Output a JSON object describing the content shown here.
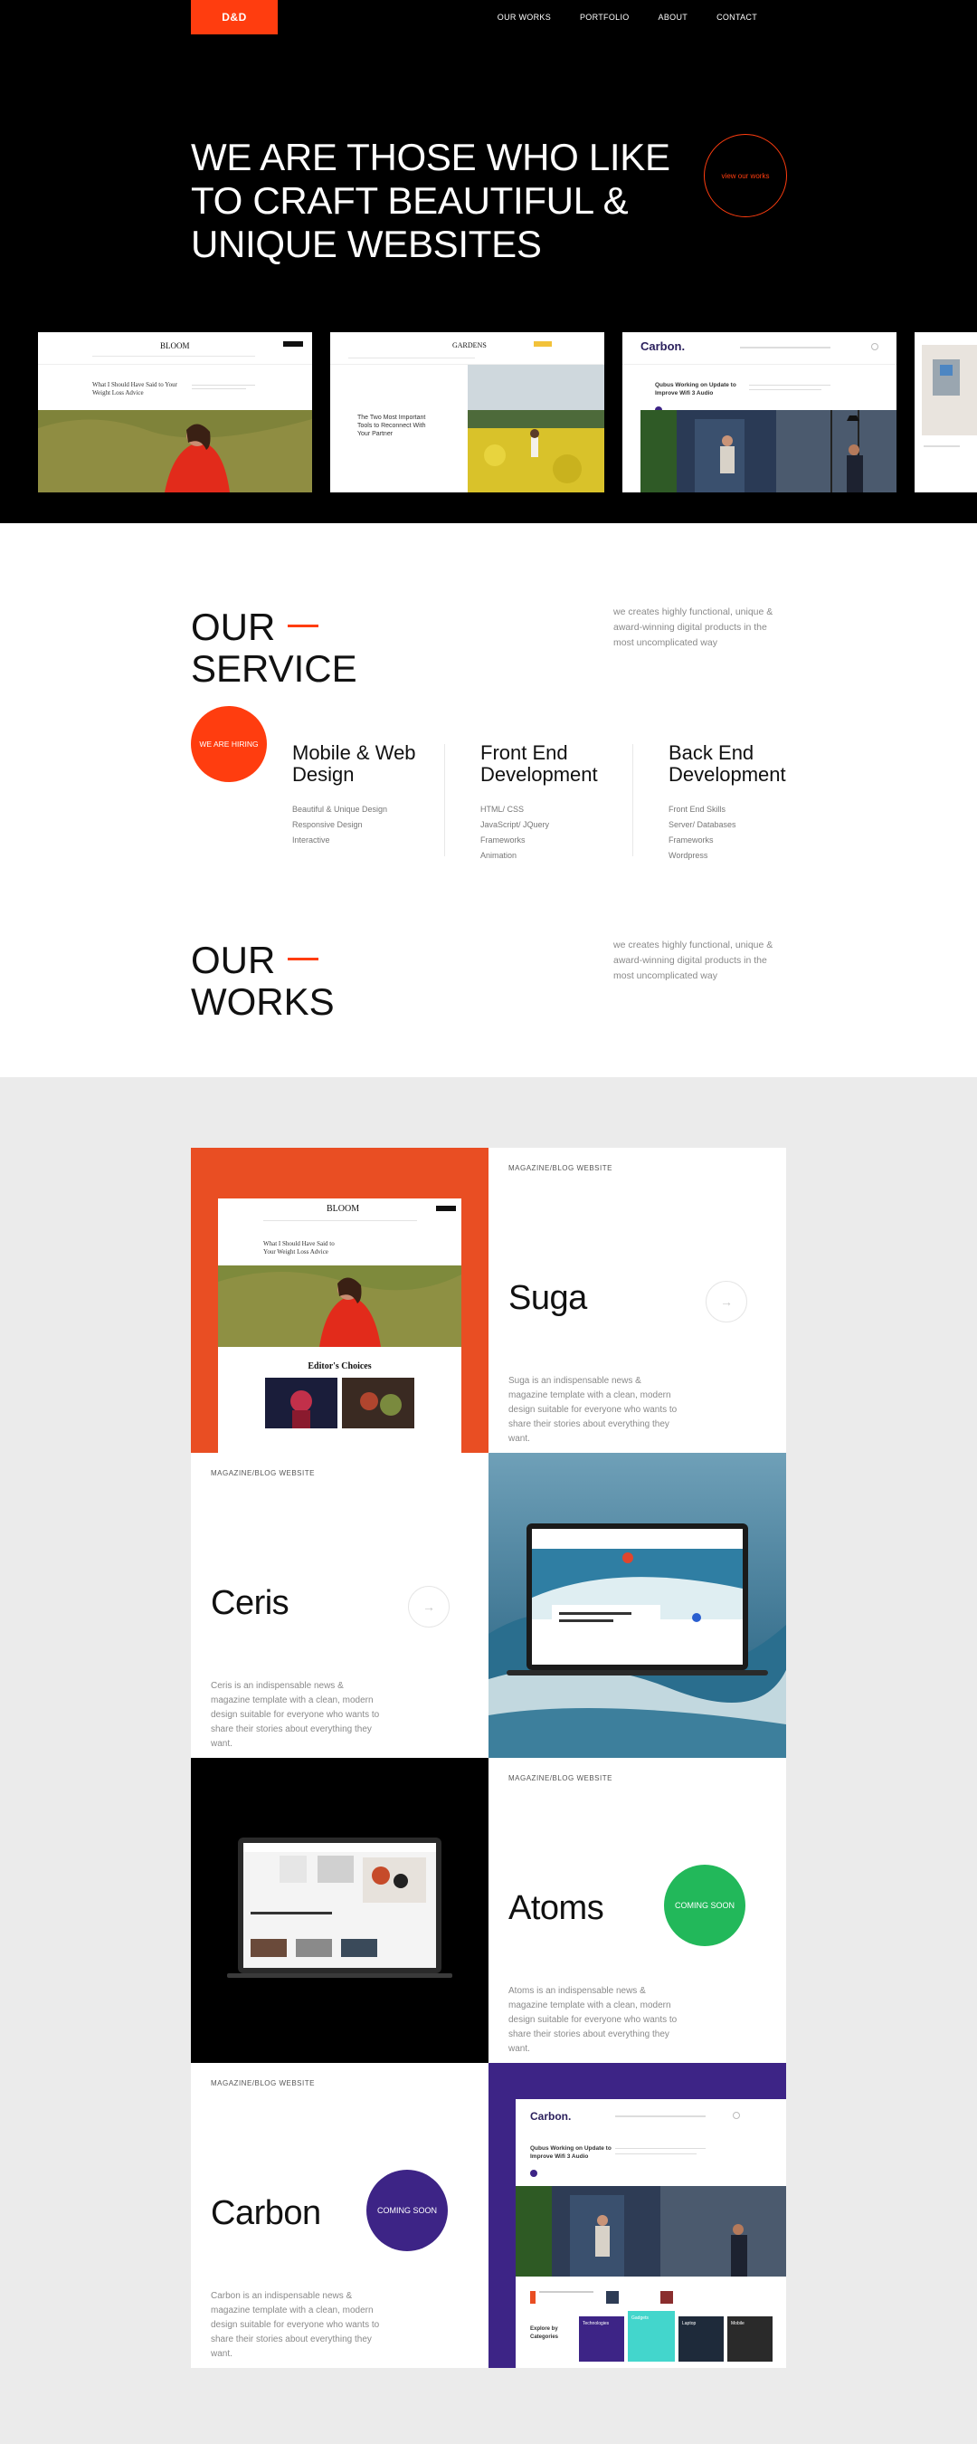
{
  "brand": {
    "logo": "D&D"
  },
  "nav": {
    "items": [
      "OUR WORKS",
      "PORTFOLIO",
      "ABOUT",
      "CONTACT"
    ]
  },
  "hero": {
    "title_lines": [
      "WE ARE THOSE WHO LIKE",
      "TO CRAFT BEAUTIFUL &",
      "UNIQUE WEBSITES"
    ],
    "view_button": "view our works"
  },
  "showcase": {
    "bloom": {
      "brand": "BLOOM",
      "headline": "What I Should Have Said to Your Weight Loss Advice"
    },
    "gardens": {
      "brand": "GARDENS",
      "headline": "The Two Most Important Tools to Reconnect With Your Partner"
    },
    "carbon": {
      "brand": "Carbon.",
      "headline": "Qubus Working on Update to Improve Wifi 3 Audio"
    }
  },
  "service": {
    "title_lines": [
      "OUR",
      "SERVICE"
    ],
    "description": "we creates highly functional, unique & award-winning digital products in the most uncomplicated way",
    "hiring": "WE ARE HIRING",
    "columns": [
      {
        "title": "Mobile & Web Design",
        "items": [
          "Beautiful & Unique Design",
          "Responsive Design",
          "Interactive"
        ]
      },
      {
        "title": "Front End Development",
        "items": [
          "HTML/ CSS",
          "JavaScript/ JQuery",
          "Frameworks",
          "Animation"
        ]
      },
      {
        "title": "Back End Development",
        "items": [
          "Front End Skills",
          "Server/ Databases",
          "Frameworks",
          "Wordpress"
        ]
      }
    ]
  },
  "works": {
    "title_lines": [
      "OUR",
      "WORKS"
    ],
    "description": "we creates highly functional, unique & award-winning digital products in the most uncomplicated way",
    "items": [
      {
        "category": "MAGAZINE/BLOG WEBSITE",
        "name": "Suga",
        "description": "Suga is an indispensable news & magazine template with a clean, modern design suitable for everyone who wants to share their stories about everything they want.",
        "badge": ""
      },
      {
        "category": "MAGAZINE/BLOG WEBSITE",
        "name": "Ceris",
        "description": "Ceris is an indispensable news & magazine template with a clean, modern design suitable for everyone who wants to share their stories about everything they want.",
        "badge": ""
      },
      {
        "category": "MAGAZINE/BLOG WEBSITE",
        "name": "Atoms",
        "description": "Atoms is an indispensable news & magazine template with a clean, modern design suitable for everyone who wants to share their stories about everything they want.",
        "badge": "COMING SOON"
      },
      {
        "category": "MAGAZINE/BLOG WEBSITE",
        "name": "Carbon",
        "description": "Carbon is an indispensable news & magazine template with a clean, modern design suitable for everyone who wants to share their stories about everything they want.",
        "badge": "COMING SOON"
      }
    ],
    "bloom_preview": {
      "brand": "BLOOM",
      "headline": "What I Should Have Said to Your Weight Loss Advice",
      "section": "Editor's Choices"
    },
    "carbon_preview": {
      "brand": "Carbon.",
      "headline": "Qubus Working on Update to Improve Wifi 3 Audio",
      "explore": "Explore by Categories",
      "cats": [
        "Technologies",
        "Gadgets",
        "Laptop",
        "Mobile"
      ]
    }
  },
  "colors": {
    "accent": "#ff3d0f",
    "green": "#22b85a",
    "purple": "#3d2486",
    "suga_bg": "#e94e23"
  },
  "icons": {
    "arrow": "arrow-right-icon"
  }
}
